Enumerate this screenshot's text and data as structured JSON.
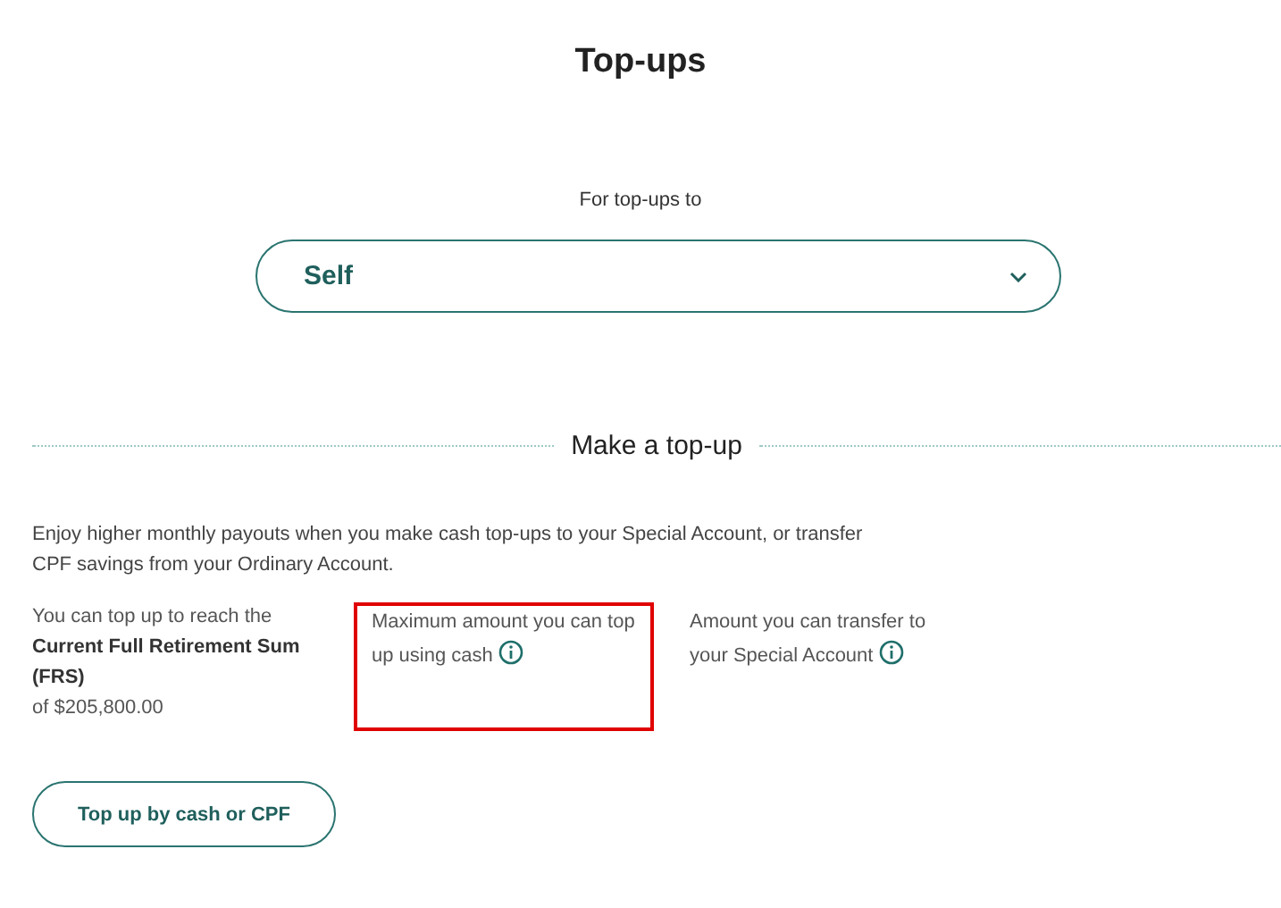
{
  "page_title": "Top-ups",
  "recipient": {
    "label": "For top-ups to",
    "value": "Self"
  },
  "section": {
    "heading": "Make a top-up",
    "intro": "Enjoy higher monthly payouts when you make cash top-ups to your Special Account, or transfer CPF savings from your Ordinary Account."
  },
  "frs": {
    "lead": "You can top up to reach the",
    "emphasis": "Current Full Retirement Sum (FRS)",
    "amount": "of $205,800.00"
  },
  "limits": [
    {
      "text": "Maximum amount you can top up using cash",
      "highlighted": true
    },
    {
      "text": "Amount you can transfer to your Special Account",
      "highlighted": false
    }
  ],
  "action_button": "Top up by cash or CPF"
}
